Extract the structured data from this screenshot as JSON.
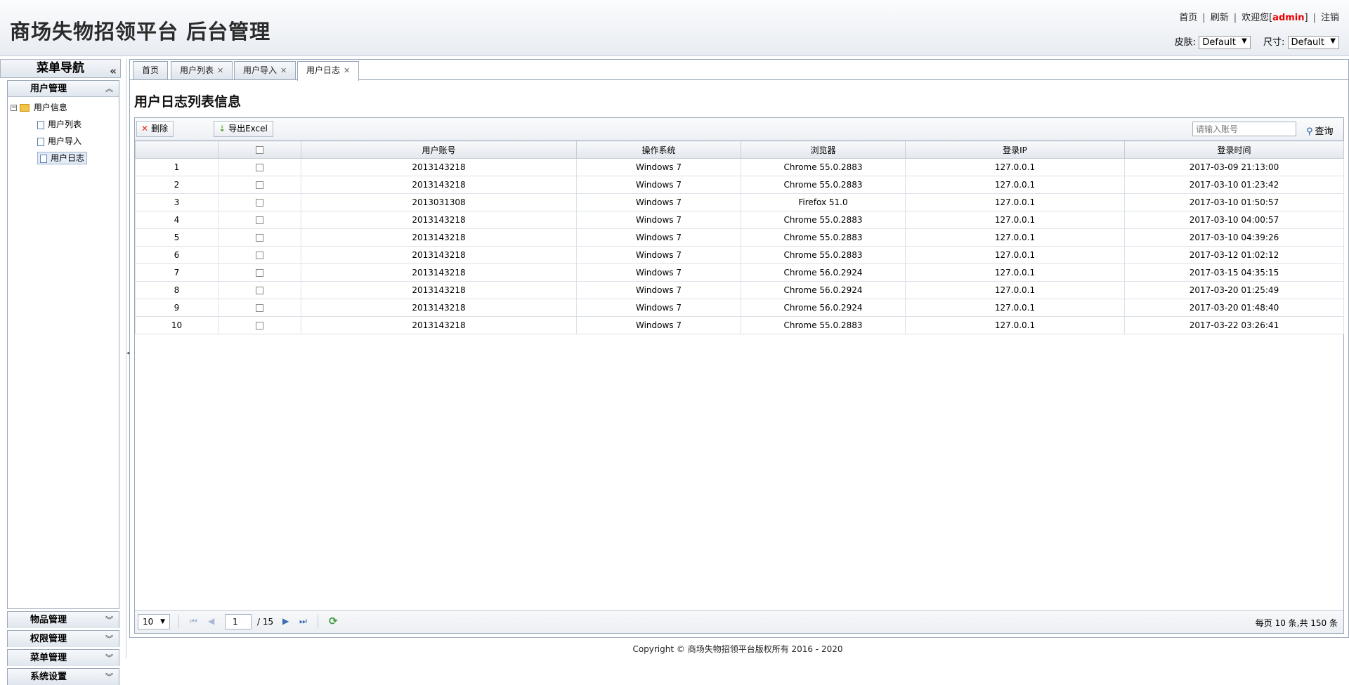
{
  "header": {
    "title": "商场失物招领平台 后台管理",
    "links": {
      "home": "首页",
      "refresh": "刷新",
      "welcome_prefix": "欢迎您[",
      "user": "admin",
      "welcome_suffix": "]",
      "logout": "注销"
    },
    "skin_label": "皮肤:",
    "skin_value": "Default",
    "size_label": "尺寸:",
    "size_value": "Default"
  },
  "sidebar": {
    "title": "菜单导航",
    "sections": {
      "user": "用户管理",
      "goods": "物品管理",
      "perm": "权限管理",
      "menu": "菜单管理",
      "system": "系统设置"
    },
    "tree": {
      "root": "用户信息",
      "items": [
        "用户列表",
        "用户导入",
        "用户日志"
      ]
    }
  },
  "tabs": {
    "home": "首页",
    "list": "用户列表",
    "import": "用户导入",
    "log": "用户日志"
  },
  "panel": {
    "title": "用户日志列表信息"
  },
  "toolbar": {
    "delete": "删除",
    "export": "导出Excel",
    "search_placeholder": "请输入账号",
    "search": "查询"
  },
  "table": {
    "headers": [
      "",
      "",
      "用户账号",
      "操作系统",
      "浏览器",
      "登录IP",
      "登录时间"
    ],
    "rows": [
      [
        "1",
        "2013143218",
        "Windows 7",
        "Chrome 55.0.2883",
        "127.0.0.1",
        "2017-03-09 21:13:00"
      ],
      [
        "2",
        "2013143218",
        "Windows 7",
        "Chrome 55.0.2883",
        "127.0.0.1",
        "2017-03-10 01:23:42"
      ],
      [
        "3",
        "2013031308",
        "Windows 7",
        "Firefox 51.0",
        "127.0.0.1",
        "2017-03-10 01:50:57"
      ],
      [
        "4",
        "2013143218",
        "Windows 7",
        "Chrome 55.0.2883",
        "127.0.0.1",
        "2017-03-10 04:00:57"
      ],
      [
        "5",
        "2013143218",
        "Windows 7",
        "Chrome 55.0.2883",
        "127.0.0.1",
        "2017-03-10 04:39:26"
      ],
      [
        "6",
        "2013143218",
        "Windows 7",
        "Chrome 55.0.2883",
        "127.0.0.1",
        "2017-03-12 01:02:12"
      ],
      [
        "7",
        "2013143218",
        "Windows 7",
        "Chrome 56.0.2924",
        "127.0.0.1",
        "2017-03-15 04:35:15"
      ],
      [
        "8",
        "2013143218",
        "Windows 7",
        "Chrome 56.0.2924",
        "127.0.0.1",
        "2017-03-20 01:25:49"
      ],
      [
        "9",
        "2013143218",
        "Windows 7",
        "Chrome 56.0.2924",
        "127.0.0.1",
        "2017-03-20 01:48:40"
      ],
      [
        "10",
        "2013143218",
        "Windows 7",
        "Chrome 55.0.2883",
        "127.0.0.1",
        "2017-03-22 03:26:41"
      ]
    ]
  },
  "pager": {
    "page_size": "10",
    "page": "1",
    "total_pages": "/ 15",
    "info": "每页 10 条,共 150 条"
  },
  "footer": {
    "copyright": "Copyright © 商场失物招领平台版权所有  2016 - 2020"
  }
}
